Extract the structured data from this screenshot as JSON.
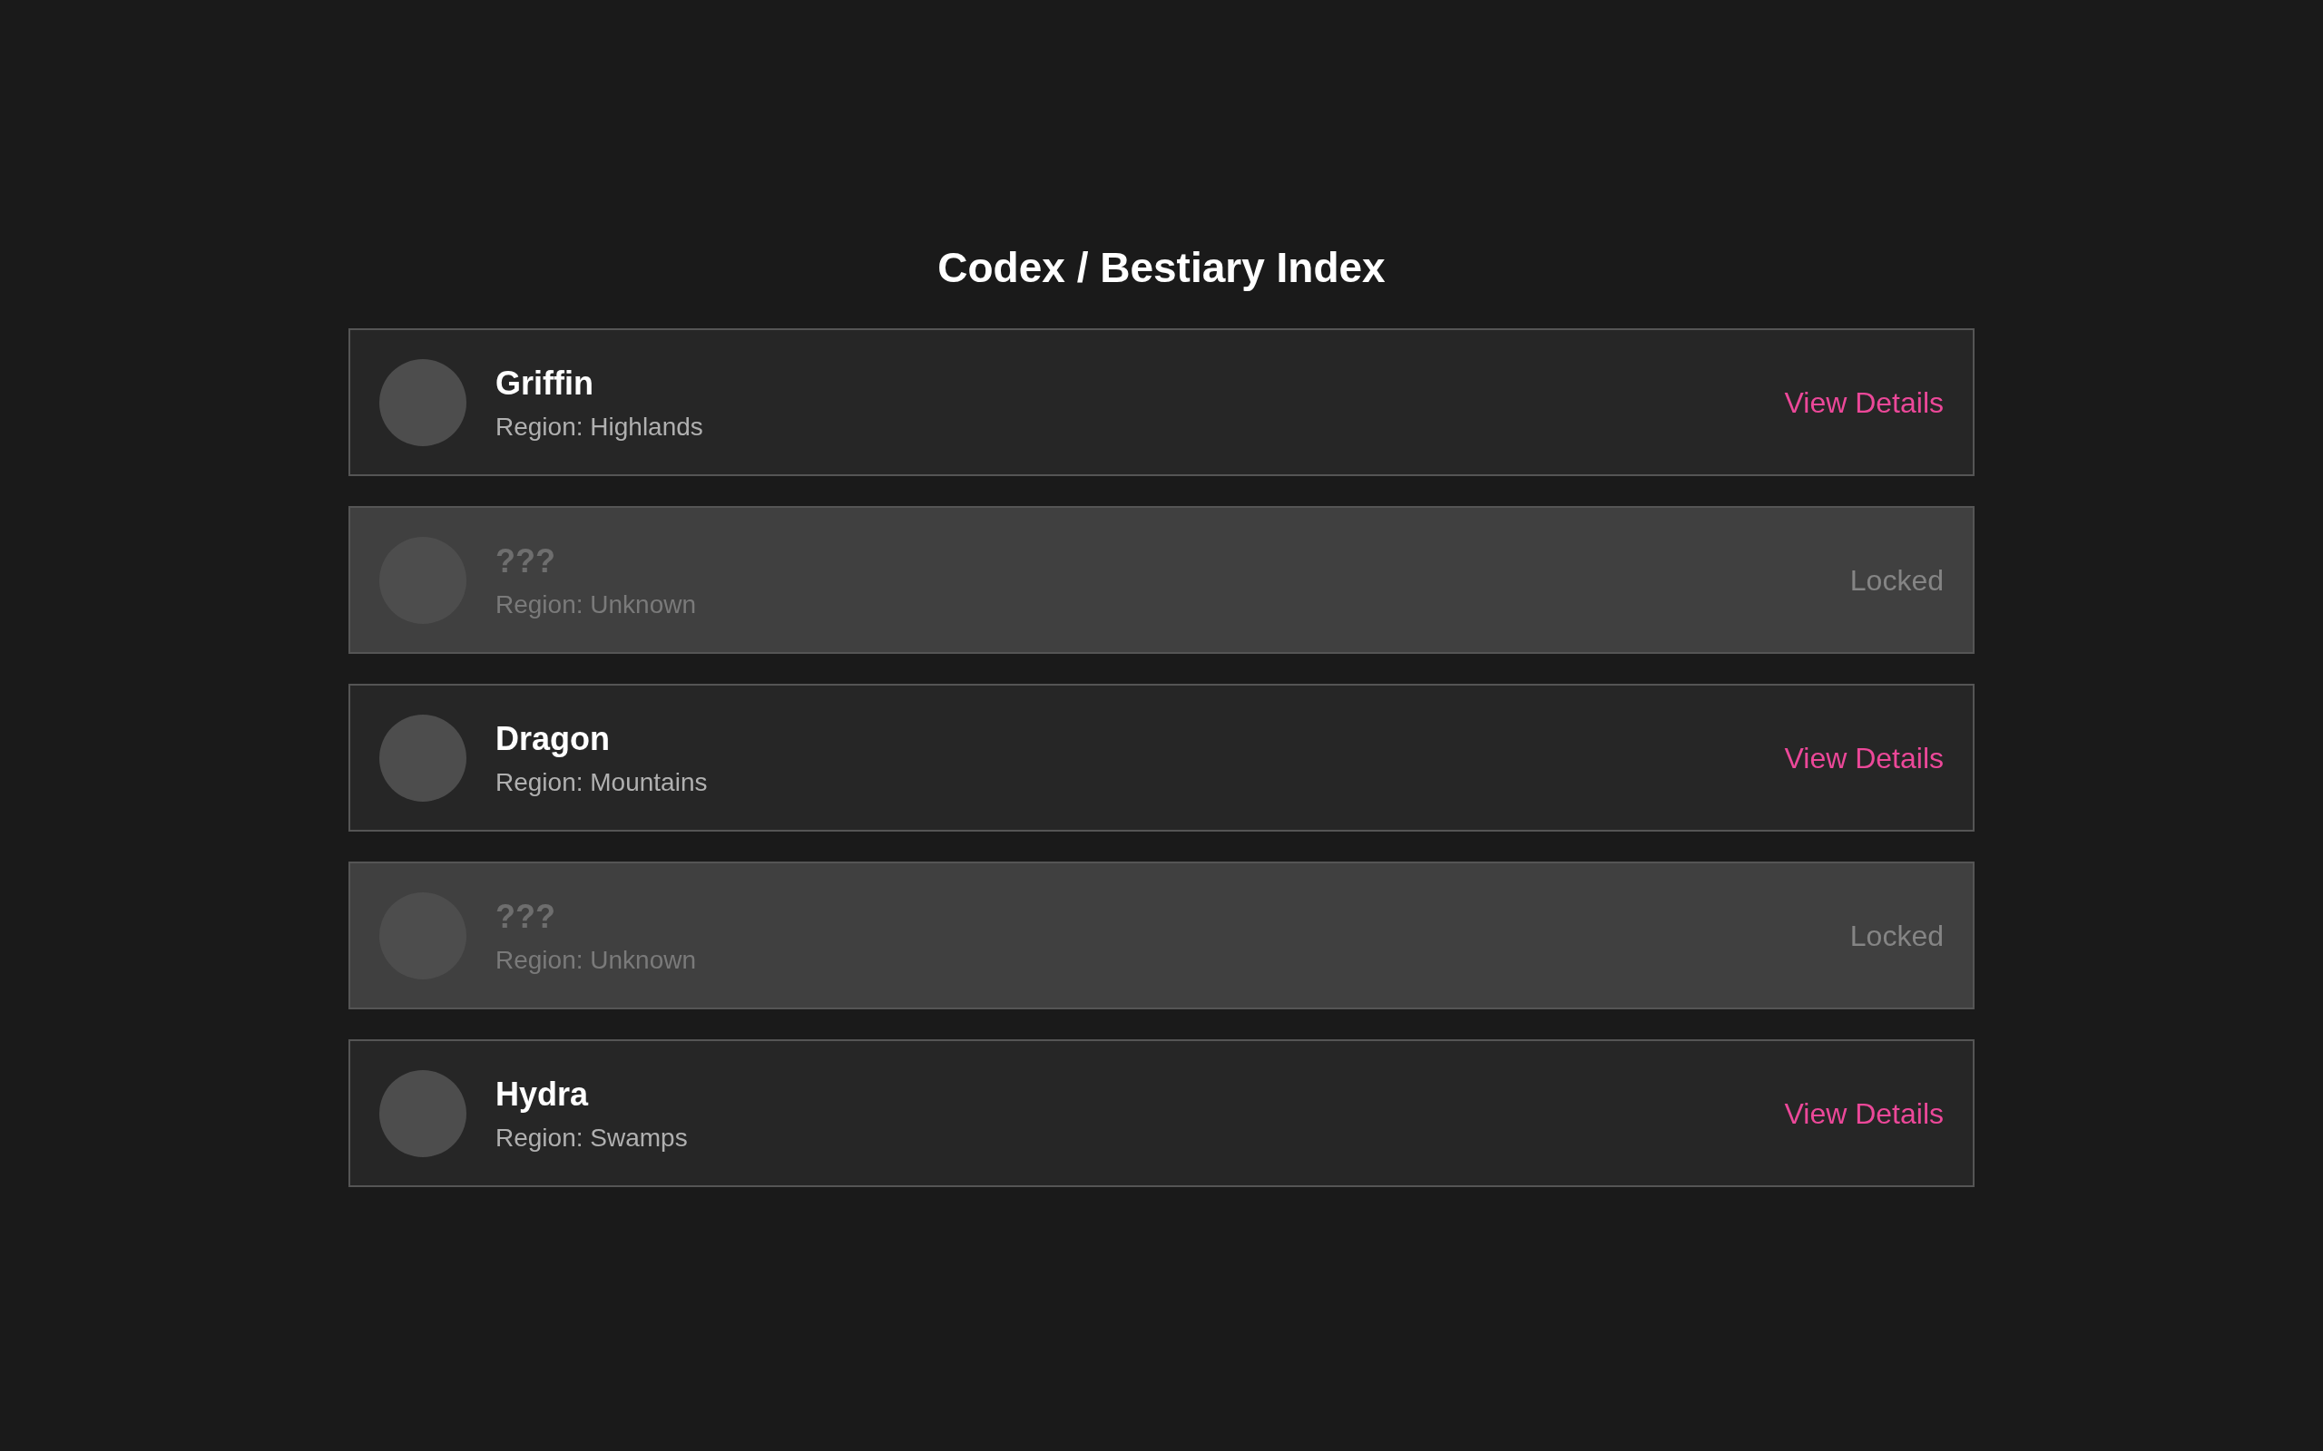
{
  "title": "Codex / Bestiary Index",
  "entries": [
    {
      "name": "Griffin",
      "region": "Region: Highlands",
      "action": "View Details",
      "locked": false
    },
    {
      "name": "???",
      "region": "Region: Unknown",
      "action": "Locked",
      "locked": true
    },
    {
      "name": "Dragon",
      "region": "Region: Mountains",
      "action": "View Details",
      "locked": false
    },
    {
      "name": "???",
      "region": "Region: Unknown",
      "action": "Locked",
      "locked": true
    },
    {
      "name": "Hydra",
      "region": "Region: Swamps",
      "action": "View Details",
      "locked": false
    }
  ]
}
